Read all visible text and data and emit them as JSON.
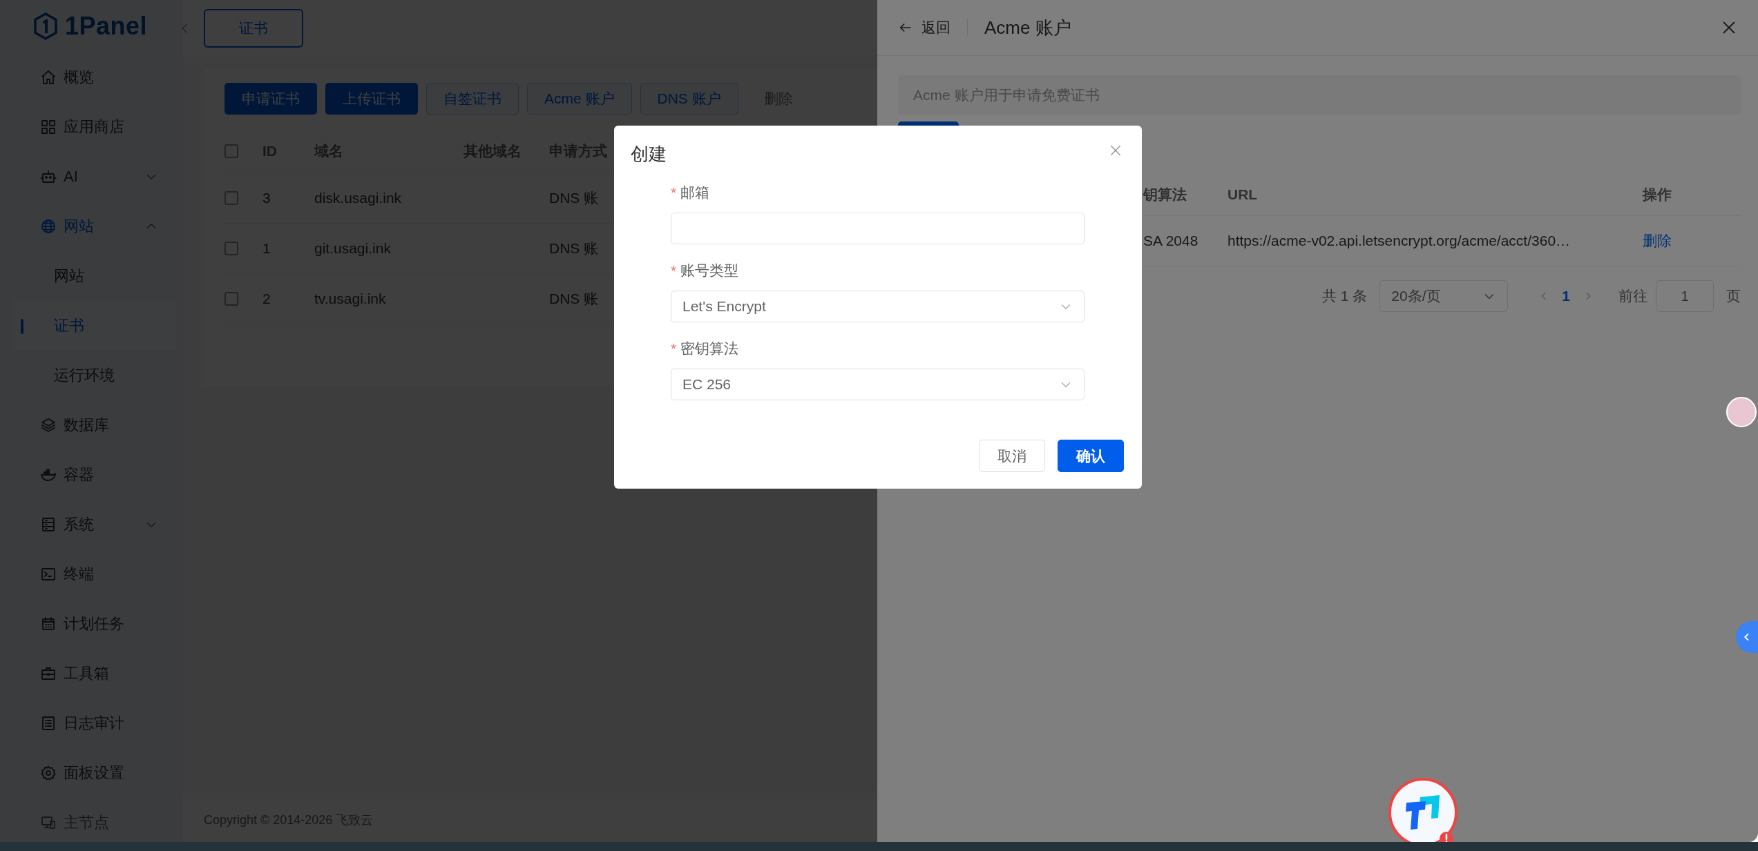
{
  "sidebar": {
    "logo": "1Panel",
    "items": [
      {
        "label": "概览",
        "selected": false
      },
      {
        "label": "应用商店",
        "selected": false
      },
      {
        "label": "AI",
        "selected": false,
        "expanded": false
      },
      {
        "label": "网站",
        "selected": true,
        "expanded": true,
        "children": [
          {
            "label": "网站",
            "selected": false
          },
          {
            "label": "证书",
            "selected": true
          },
          {
            "label": "运行环境",
            "selected": false
          }
        ]
      },
      {
        "label": "数据库",
        "selected": false
      },
      {
        "label": "容器",
        "selected": false
      },
      {
        "label": "系统",
        "selected": false,
        "expanded": false
      },
      {
        "label": "终端",
        "selected": false
      },
      {
        "label": "计划任务",
        "selected": false
      },
      {
        "label": "工具箱",
        "selected": false
      },
      {
        "label": "日志审计",
        "selected": false
      },
      {
        "label": "面板设置",
        "selected": false
      }
    ],
    "node_switch": {
      "label": "主节点",
      "disabled": true
    }
  },
  "tabs": [
    {
      "label": "证书",
      "selected": true
    }
  ],
  "toolbar": [
    {
      "label": "申请证书",
      "kind": "primary"
    },
    {
      "label": "上传证书",
      "kind": "primary"
    },
    {
      "label": "自签证书",
      "kind": "plain"
    },
    {
      "label": "Acme 账户",
      "kind": "plain"
    },
    {
      "label": "DNS 账户",
      "kind": "plain"
    },
    {
      "label": "删除",
      "kind": "disabled"
    }
  ],
  "table": {
    "select_all_checked": false,
    "columns": [
      "ID",
      "域名",
      "其他域名",
      "申请方式"
    ],
    "rows": [
      {
        "checked": false,
        "cells": [
          "3",
          "disk.usagi.ink",
          "DNS 账"
        ]
      },
      {
        "checked": false,
        "cells": [
          "1",
          "git.usagi.ink",
          "DNS 账"
        ]
      },
      {
        "checked": false,
        "cells": [
          "2",
          "tv.usagi.ink",
          "DNS 账"
        ]
      }
    ]
  },
  "footer": "Copyright © 2014-2026 飞致云",
  "drawer": {
    "back": "返回",
    "title": "Acme 账户",
    "alert": "Acme 账户用于申请免费证书",
    "table": {
      "columns": [
        "钥算法",
        "URL",
        "操作"
      ],
      "rows": [
        {
          "cells": [
            "SA 2048",
            "https://acme-v02.api.letsencrypt.org/acme/acct/360…",
            "删除"
          ]
        }
      ]
    },
    "pagination": {
      "total": "共 1 条",
      "page_size": "20条/页",
      "pages": [
        {
          "label": "1",
          "selected": true
        }
      ],
      "goto_label": "前往",
      "goto_value": "1",
      "goto_suffix": "页"
    }
  },
  "dialog": {
    "title": "创建",
    "fields": [
      {
        "label": "邮箱",
        "required_mark": "*",
        "kind": "input"
      },
      {
        "label": "账号类型",
        "required_mark": "*",
        "kind": "select",
        "value": "Let's Encrypt"
      },
      {
        "label": "密钥算法",
        "required_mark": "*",
        "kind": "select",
        "value": "EC 256"
      }
    ],
    "buttons": [
      {
        "label": "取消",
        "kind": "default"
      },
      {
        "label": "确认",
        "kind": "primary"
      }
    ]
  }
}
